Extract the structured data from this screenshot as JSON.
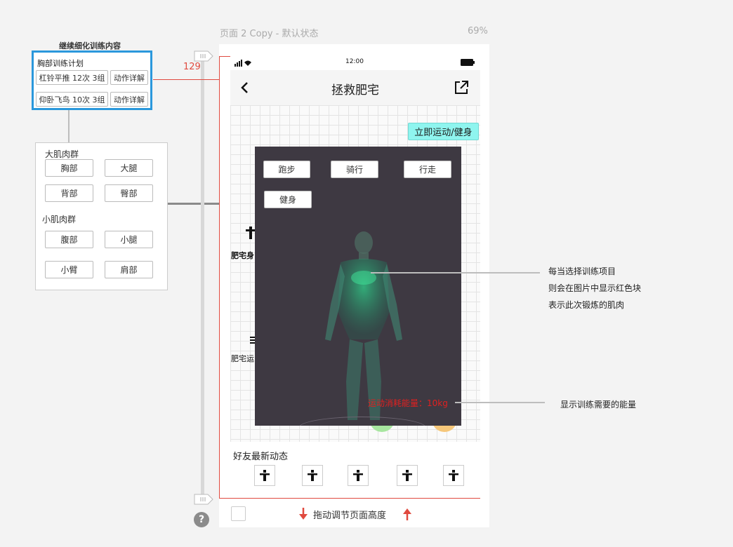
{
  "left_panel": {
    "title": "继续细化训练内容",
    "plan": {
      "title": "胸部训练计划",
      "items": [
        {
          "text": "杠铃平推 12次 3组",
          "detail": "动作详解"
        },
        {
          "text": "仰卧飞鸟 10次 3组",
          "detail": "动作详解"
        }
      ]
    },
    "muscles": {
      "big_title": "大肌肉群",
      "big": [
        "胸部",
        "大腿",
        "背部",
        "臀部"
      ],
      "small_title": "小肌肉群",
      "small": [
        "腹部",
        "小腿",
        "小臂",
        "肩部"
      ]
    }
  },
  "ruler": {
    "value": "129"
  },
  "page": {
    "name": "页面 2 Copy - 默认状态",
    "zoom": "69%"
  },
  "status_bar": {
    "time": "12:00"
  },
  "nav": {
    "title": "拯救肥宅"
  },
  "start_button": "立即运动/健身",
  "overlay": {
    "buttons": [
      "跑步",
      "骑行",
      "行走",
      "健身"
    ],
    "energy": "运动消耗能量：10kg"
  },
  "side_labels": [
    "肥宅身",
    "肥宅运"
  ],
  "friends": {
    "title": "好友最新动态",
    "count": 5
  },
  "bottom": {
    "drag_label": "拖动调节页面高度"
  },
  "annotations": {
    "muscle": [
      "每当选择训练项目",
      "则会在图片中显示红色块",
      "表示此次锻炼的肌肉"
    ],
    "energy": "显示训练需要的能量"
  },
  "colors": {
    "accent": "#e04a3f",
    "highlight": "#1e8fd8",
    "start_btn_bg": "#8ff5ef",
    "overlay_bg": "#3e3942",
    "energy_text": "#e02020"
  }
}
